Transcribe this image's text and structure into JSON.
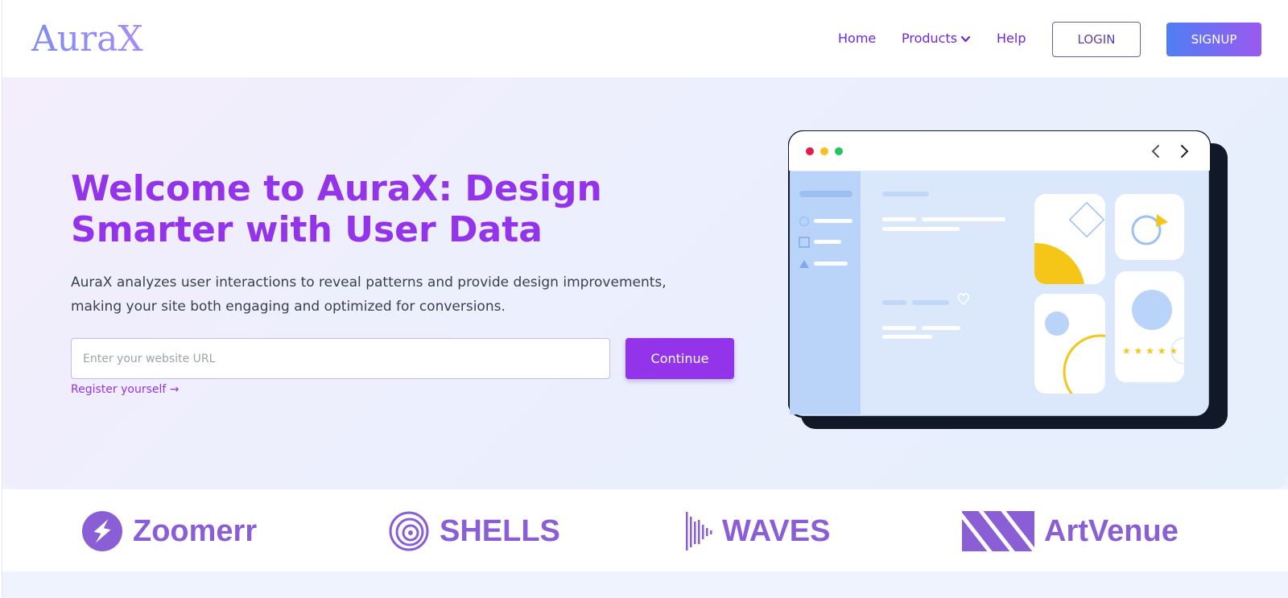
{
  "brand": {
    "logo_text": "AuraX"
  },
  "nav": {
    "home": "Home",
    "products": "Products",
    "help": "Help",
    "login": "LOGIN",
    "signup": "SIGNUP"
  },
  "hero": {
    "title": "Welcome to AuraX: Design Smarter with User Data",
    "description": "AuraX analyzes user interactions to reveal patterns and provide design improvements, making your site both engaging and optimized for conversions.",
    "url_placeholder": "Enter your website URL",
    "url_value": "",
    "continue_label": "Continue",
    "register_link": "Register yourself →"
  },
  "partners": [
    {
      "name": "Zoomerr",
      "icon": "lightning-bolt-icon"
    },
    {
      "name": "SHELLS",
      "icon": "spiral-shell-icon"
    },
    {
      "name": "WAVES",
      "icon": "sound-wave-icon"
    },
    {
      "name": "ArtVenue",
      "icon": "diagonal-stripes-icon"
    }
  ],
  "colors": {
    "accent": "#9333ea",
    "nav_text": "#6d28d9",
    "signup_gradient_start": "#4f7ff2",
    "signup_gradient_end": "#9b59f0",
    "partner_logo": "#8a5fd6",
    "mockup_dot_red": "#e11d48",
    "mockup_dot_yellow": "#fbbf24",
    "mockup_dot_green": "#22c55e",
    "mockup_yellow": "#f5c518"
  }
}
